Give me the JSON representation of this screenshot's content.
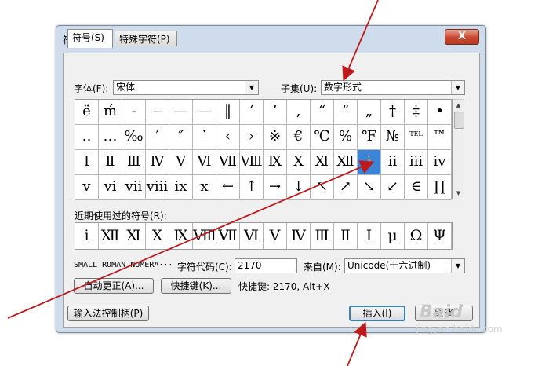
{
  "dialog": {
    "title": "符号",
    "close_label": "X"
  },
  "tabs": [
    "符号(S)",
    "特殊字符(P)"
  ],
  "font": {
    "label": "字体(F):",
    "value": "宋体"
  },
  "subset": {
    "label": "子集(U):",
    "value": "数字形式"
  },
  "grid_rows": [
    [
      "ë",
      "ḿ",
      "-",
      "‒",
      "—",
      "―",
      "‖",
      "‘",
      "’",
      "‚",
      "“",
      "”",
      "„",
      "†",
      "‡",
      "•"
    ],
    [
      "‥",
      "…",
      "‰",
      "′",
      "″",
      "‵",
      "‹",
      "›",
      "※",
      "€",
      "℃",
      "%",
      "℉",
      "№",
      "TEL",
      "™"
    ],
    [
      "Ⅰ",
      "Ⅱ",
      "Ⅲ",
      "Ⅳ",
      "Ⅴ",
      "Ⅵ",
      "Ⅶ",
      "Ⅷ",
      "Ⅸ",
      "Ⅹ",
      "Ⅺ",
      "Ⅻ",
      "ⅰ",
      "ⅱ",
      "ⅲ",
      "ⅳ"
    ],
    [
      "ⅴ",
      "ⅵ",
      "ⅶ",
      "ⅷ",
      "ⅸ",
      "ⅹ",
      "←",
      "↑",
      "→",
      "↓",
      "↖",
      "↗",
      "↘",
      "↙",
      "∈",
      "∏"
    ]
  ],
  "recent": {
    "label": "近期使用过的符号(R):",
    "items": [
      "ⅰ",
      "Ⅻ",
      "Ⅺ",
      "Ⅹ",
      "Ⅸ",
      "Ⅷ",
      "Ⅶ",
      "Ⅵ",
      "Ⅴ",
      "Ⅳ",
      "Ⅲ",
      "Ⅱ",
      "Ⅰ",
      "μ",
      "Ω",
      "Ψ"
    ]
  },
  "char_name": "SMALL ROMAN NUMERA···",
  "char_code": {
    "label": "字符代码(C):",
    "value": "2170"
  },
  "from": {
    "label": "来自(M):",
    "value": "Unicode(十六进制)"
  },
  "autocorrect_label": "自动更正(A)...",
  "shortcut_key_label": "快捷键(K)...",
  "shortcut_text": "快捷键: 2170, Alt+X",
  "ime_label": "输入法控制柄(P)",
  "insert_label": "插入(I)",
  "cancel_label": "取消",
  "watermark": "Baid",
  "watermark_url": "jingyan.baidu.com",
  "colors": {
    "selection": "#3c84d6",
    "annotation_arrow": "#c0191c"
  }
}
